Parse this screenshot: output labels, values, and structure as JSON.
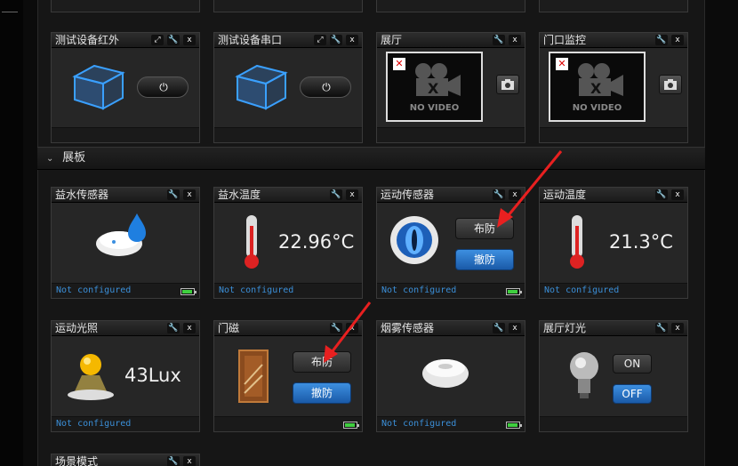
{
  "section": {
    "title": "展板"
  },
  "top_row": [
    {
      "title": "测试设备红外"
    },
    {
      "title": "测试设备串口"
    },
    {
      "title": "展厅",
      "video_text": "NO VIDEO"
    },
    {
      "title": "门口监控",
      "video_text": "NO VIDEO"
    }
  ],
  "row2": {
    "water_sensor": {
      "title": "益水传感器",
      "status": "Not configured"
    },
    "water_temp": {
      "title": "益水温度",
      "value": "22.96°C",
      "status": "Not configured"
    },
    "motion_sensor": {
      "title": "运动传感器",
      "arm_label": "布防",
      "disarm_label": "撤防",
      "status": "Not configured"
    },
    "motion_temp": {
      "title": "运动温度",
      "value": "21.3°C",
      "status": "Not configured"
    }
  },
  "row3": {
    "motion_light": {
      "title": "运动光照",
      "value": "43Lux",
      "status": "Not configured"
    },
    "door": {
      "title": "门磁",
      "arm_label": "布防",
      "disarm_label": "撤防"
    },
    "smoke": {
      "title": "烟雾传感器",
      "status": "Not configured"
    },
    "hall_light": {
      "title": "展厅灯光",
      "on_label": "ON",
      "off_label": "OFF"
    }
  },
  "row4": {
    "scene": {
      "title": "场景模式"
    }
  },
  "icons": [
    "expand-icon",
    "settings-icon",
    "close-icon",
    "power-icon",
    "camera-icon",
    "battery-icon",
    "chevron-down-icon"
  ]
}
